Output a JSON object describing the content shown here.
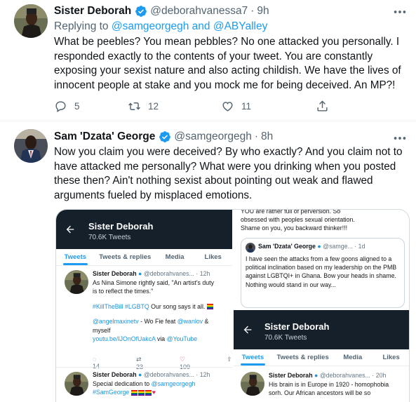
{
  "tweet1": {
    "name": "Sister Deborah",
    "handle": "@deborahvanessa7",
    "time": "9h",
    "replying_prefix": "Replying to",
    "replying_to": "@samgeorgegh and @ABYalley",
    "text": "What be peebles? You mean pebbles? No one attacked you personally. I responded exactly to the contents of your tweet. You are constantly exposing your sexist nature and also acting childish. We have the lives of innocent people at stake and you mock me for being deceived. An MP?!",
    "replies": "5",
    "retweets": "12",
    "likes": "11"
  },
  "tweet2": {
    "name": "Sam 'Dzata' George",
    "handle": "@samgeorgegh",
    "time": "8h",
    "text": "Now you claim you were deceived? By who exactly? And you claim not to have attacked me personally? What were you drinking when you posted these then? Ain't nothing sexist about pointing out weak and flawed arguments fueled by misplaced emotions."
  },
  "shot_left": {
    "title": "Sister Deborah",
    "sub": "70.6K Tweets",
    "tabs": [
      "Tweets",
      "Tweets & replies",
      "Media",
      "Likes"
    ],
    "t1_name": "Sister Deborah",
    "t1_handle": "@deborahvanes...",
    "t1_time": "12h",
    "t1_line1": "As Nina Simone rightly said, \"An artist's duty",
    "t1_line2": "is to reflect the times.\"",
    "t1_tags": "#KillTheBill #LGBTQ",
    "t1_tags_rest": "Our song says it all.",
    "t1_mention": "@angelmaxinetv",
    "t1_mid": "- Wo Fie feat",
    "t1_mention2": "@wanlov",
    "t1_and": "&",
    "t1_myself": "myself",
    "t1_link": "youtu.be/IJOnOfUakcA",
    "t1_via": "via",
    "t1_yt": "@YouTube",
    "t1_replies": "14",
    "t1_rts": "23",
    "t1_likes": "109",
    "t2_name": "Sister Deborah",
    "t2_handle": "@deborahvanes...",
    "t2_time": "12h",
    "t2_line1": "Special dedication to",
    "t2_mention": "@samgeorgegh",
    "t2_tag": "#SamGeorge"
  },
  "shot_right_top": {
    "line1": "YOU are rather full of perversion. So",
    "line2": "obsessed with peoples sexual orientation.",
    "line3": "Shame on you, you backward thinker!!!",
    "q_name": "Sam 'Dzata' George",
    "q_handle": "@samge...",
    "q_time": "1d",
    "q_text": "I have seen the attacks from a few goons aligned to a political inclination based on my leadership on the PMB against LGBTQI+ in Ghana. Bow your heads in shame. Nothing would stand in our way..."
  },
  "shot_right_bottom": {
    "title": "Sister Deborah",
    "sub": "70.6K Tweets",
    "tabs": [
      "Tweets",
      "Tweets & replies",
      "Media",
      "Likes"
    ],
    "t_name": "Sister Deborah",
    "t_handle": "@deborahvanes...",
    "t_time": "20h",
    "t_line1": "His brain is in Europe in 1920 - homophobia",
    "t_line2": "sorh. Our African ancestors will be so"
  },
  "colors": {
    "accent": "#1d9bf0",
    "muted": "#536471",
    "dark_header": "#15202b"
  }
}
